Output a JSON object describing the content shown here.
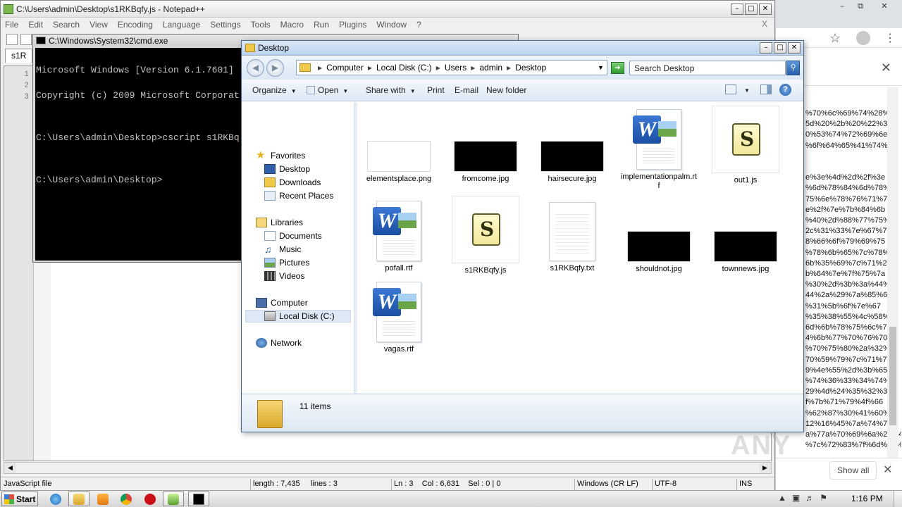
{
  "notepadpp": {
    "title": "C:\\Users\\admin\\Desktop\\s1RKBqfy.js - Notepad++",
    "menu": [
      "File",
      "Edit",
      "Search",
      "View",
      "Encoding",
      "Language",
      "Settings",
      "Tools",
      "Macro",
      "Run",
      "Plugins",
      "Window",
      "?"
    ],
    "close_x": "X",
    "tab_label": "s1R",
    "line_numbers": [
      "1",
      "2",
      "3"
    ],
    "status": {
      "file_type": "JavaScript file",
      "length": "length : 7,435",
      "lines": "lines : 3",
      "position": "Ln : 3    Col : 6,631    Sel : 0 | 0",
      "eol": "Windows (CR LF)",
      "encoding": "UTF-8",
      "mode": "INS"
    }
  },
  "cmd": {
    "title": "C:\\Windows\\System32\\cmd.exe",
    "lines": [
      "Microsoft Windows [Version 6.1.7601]",
      "Copyright (c) 2009 Microsoft Corporat",
      "",
      "C:\\Users\\admin\\Desktop>cscript s1RKBq",
      "",
      "C:\\Users\\admin\\Desktop>"
    ]
  },
  "explorer": {
    "title": "Desktop",
    "breadcrumb": [
      "Computer",
      "Local Disk (C:)",
      "Users",
      "admin",
      "Desktop"
    ],
    "search_placeholder": "Search Desktop",
    "commands": {
      "organize": "Organize",
      "open": "Open",
      "share_with": "Share with",
      "print": "Print",
      "email": "E-mail",
      "new_folder": "New folder"
    },
    "nav": {
      "favorites": "Favorites",
      "desktop": "Desktop",
      "downloads": "Downloads",
      "recent_places": "Recent Places",
      "libraries": "Libraries",
      "documents": "Documents",
      "music": "Music",
      "pictures": "Pictures",
      "videos": "Videos",
      "computer": "Computer",
      "local_disk": "Local Disk (C:)",
      "network": "Network"
    },
    "files": [
      {
        "name": "elementsplace.png",
        "type": "image-white"
      },
      {
        "name": "fromcome.jpg",
        "type": "image-dark"
      },
      {
        "name": "hairsecure.jpg",
        "type": "image-dark"
      },
      {
        "name": "implementationpalm.rtf",
        "type": "word"
      },
      {
        "name": "out1.js",
        "type": "script"
      },
      {
        "name": "pofall.rtf",
        "type": "word"
      },
      {
        "name": "s1RKBqfy.js",
        "type": "script"
      },
      {
        "name": "s1RKBqfy.txt",
        "type": "text"
      },
      {
        "name": "shouldnot.jpg",
        "type": "image-dark"
      },
      {
        "name": "townnews.jpg",
        "type": "image-dark"
      },
      {
        "name": "vagas.rtf",
        "type": "word"
      }
    ],
    "item_count": "11 items"
  },
  "chrome": {
    "encoded_lines": [
      "%70%6c%69%74%28%",
      "5d%20%2b%20%22%3",
      "0%53%74%72%69%6e",
      "%6f%64%65%41%74%",
      "",
      "",
      "e%3e%4d%2d%2f%3e",
      "%6d%78%84%6d%78%",
      "75%6e%78%76%71%7",
      "e%2f%7e%7b%84%6b",
      "%40%2d%88%77%75%",
      "2c%31%33%7e%67%7",
      "8%66%6f%79%69%75",
      "%78%6b%65%7c%78%",
      "6b%35%69%7c%71%2",
      "b%64%7e%7f%75%7a",
      "%30%2d%3b%3a%44%",
      "44%2a%29%7a%85%6",
      "%31%5b%6f%7e%67",
      "%35%38%55%4c%58%",
      "6d%6b%78%75%6c%7",
      "4%6b%77%70%76%70",
      "%70%75%80%2a%32%",
      "70%59%79%7c%71%7",
      "9%4e%55%2d%3b%65",
      "%74%36%33%34%74%",
      "29%4d%24%35%32%3",
      "f%7b%71%79%4f%66",
      "%62%87%30%41%60%",
      "12%16%45%7a%74%7",
      "a%77a%70%69%6a%2e%45",
      "%7c%72%83%7f%6d%82%22%"
    ],
    "show_all": "Show all",
    "watermark": "ANY"
  },
  "taskbar": {
    "start_label": "Start",
    "clock": "1:16 PM"
  }
}
